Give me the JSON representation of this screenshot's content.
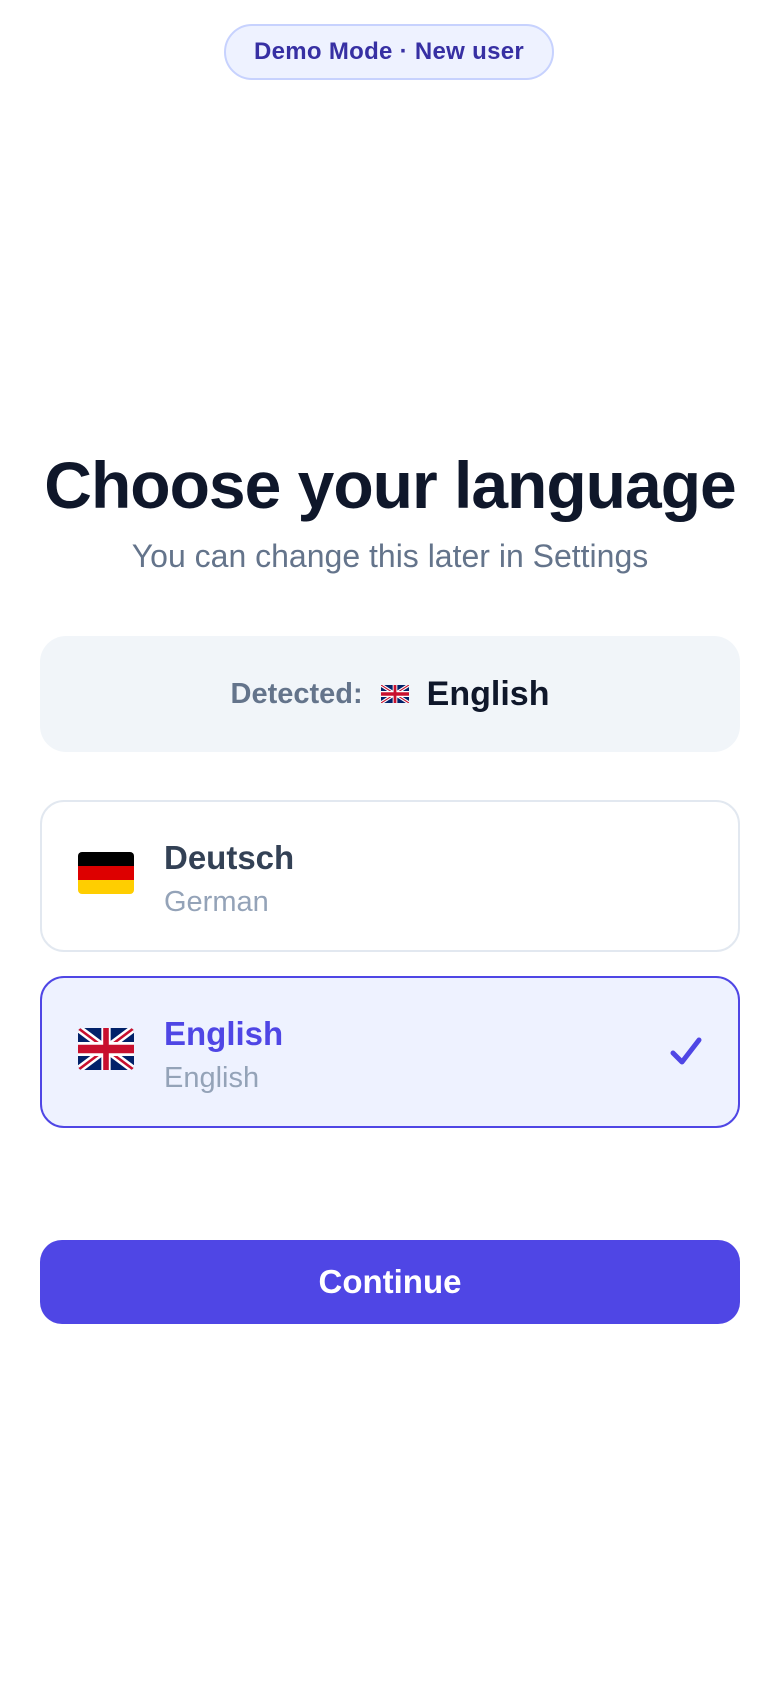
{
  "badge": {
    "label": "Demo Mode · New user"
  },
  "header": {
    "title": "Choose your language",
    "subtitle": "You can change this later in Settings"
  },
  "detected": {
    "label": "Detected:",
    "flag_icon": "uk-flag-icon",
    "value": "English"
  },
  "languages": [
    {
      "name": "Deutsch",
      "native": "German",
      "flag_icon": "german-flag-icon",
      "selected": false
    },
    {
      "name": "English",
      "native": "English",
      "flag_icon": "uk-flag-icon",
      "selected": true
    }
  ],
  "actions": {
    "continue_label": "Continue"
  },
  "colors": {
    "accent": "#4f46e5",
    "accent_light": "#eef2ff",
    "title": "#0f172a",
    "muted": "#64748b"
  }
}
